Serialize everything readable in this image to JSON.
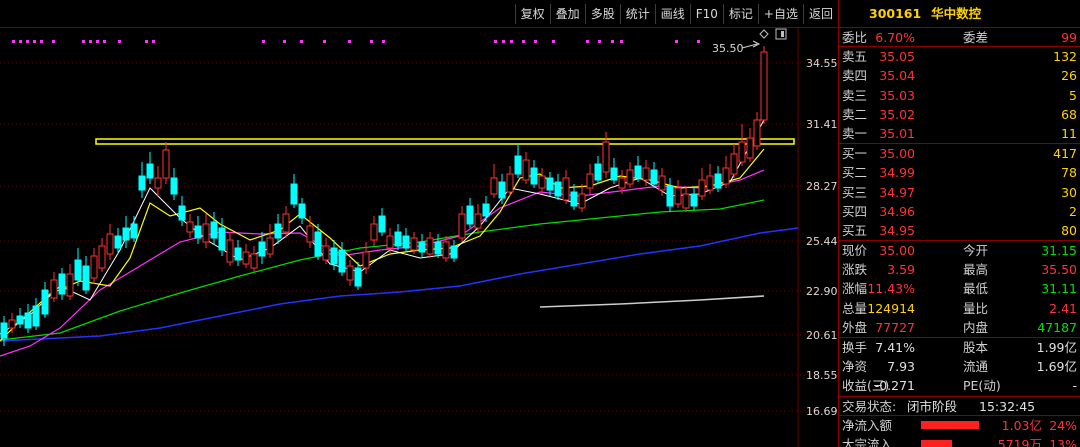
{
  "toolbar": {
    "buttons": [
      "复权",
      "叠加",
      "多股",
      "统计",
      "画线",
      "F10",
      "标记",
      "+自选",
      "返回"
    ]
  },
  "chart": {
    "price_levels": [
      "34.55",
      "31.41",
      "28.27",
      "25.44",
      "22.90",
      "20.61",
      "18.55",
      "16.69"
    ],
    "high_marker": "35.50"
  },
  "stock": {
    "code": "300161",
    "name": "华中数控"
  },
  "weibi": {
    "label": "委比",
    "value": "6.70%",
    "label2": "委差",
    "value2": "99"
  },
  "sell": [
    {
      "label": "卖五",
      "price": "35.05",
      "volume": "132"
    },
    {
      "label": "卖四",
      "price": "35.04",
      "volume": "26"
    },
    {
      "label": "卖三",
      "price": "35.03",
      "volume": "5"
    },
    {
      "label": "卖二",
      "price": "35.02",
      "volume": "68"
    },
    {
      "label": "卖一",
      "price": "35.01",
      "volume": "11"
    }
  ],
  "buy": [
    {
      "label": "买一",
      "price": "35.00",
      "volume": "417"
    },
    {
      "label": "买二",
      "price": "34.99",
      "volume": "78"
    },
    {
      "label": "买三",
      "price": "34.97",
      "volume": "30"
    },
    {
      "label": "买四",
      "price": "34.96",
      "volume": "2"
    },
    {
      "label": "买五",
      "price": "34.95",
      "volume": "80"
    }
  ],
  "quote": [
    {
      "l1": "现价",
      "v1": "35.00",
      "l2": "今开",
      "v2": "31.15"
    },
    {
      "l1": "涨跌",
      "v1": "3.59",
      "l2": "最高",
      "v2": "35.50"
    },
    {
      "l1": "涨幅",
      "v1": "11.43%",
      "l2": "最低",
      "v2": "31.11"
    },
    {
      "l1": "总量",
      "v1": "124914",
      "l2": "量比",
      "v2": "2.41"
    },
    {
      "l1": "外盘",
      "v1": "77727",
      "l2": "内盘",
      "v2": "47187"
    }
  ],
  "fundamentals": [
    {
      "l1": "换手",
      "v1": "7.41%",
      "l2": "股本",
      "v2": "1.99亿"
    },
    {
      "l1": "净资",
      "v1": "7.93",
      "l2": "流通",
      "v2": "1.69亿"
    },
    {
      "l1": "收益(三)",
      "v1": "-0.271",
      "l2": "PE(动)",
      "v2": "-"
    }
  ],
  "status": {
    "label": "交易状态:",
    "state": "闭市阶段",
    "time": "15:32:45"
  },
  "flows": [
    {
      "label": "净流入额",
      "value": "1.03亿",
      "pct": "24%",
      "bar_fraction": 0.24
    },
    {
      "label": "大宗流入",
      "value": "5719万",
      "pct": "13%",
      "bar_fraction": 0.13
    }
  ],
  "colors": {
    "up": "#ff3333",
    "down": "#00ffff",
    "ma5": "#ffffff",
    "ma10": "#ffff00",
    "ma20": "#ff33ff",
    "ma60": "#00dd00",
    "ma120": "#2233ff",
    "ma250": "#cccccc",
    "resistance": "#ffff00",
    "purple_dots": "#ff33ff"
  }
}
